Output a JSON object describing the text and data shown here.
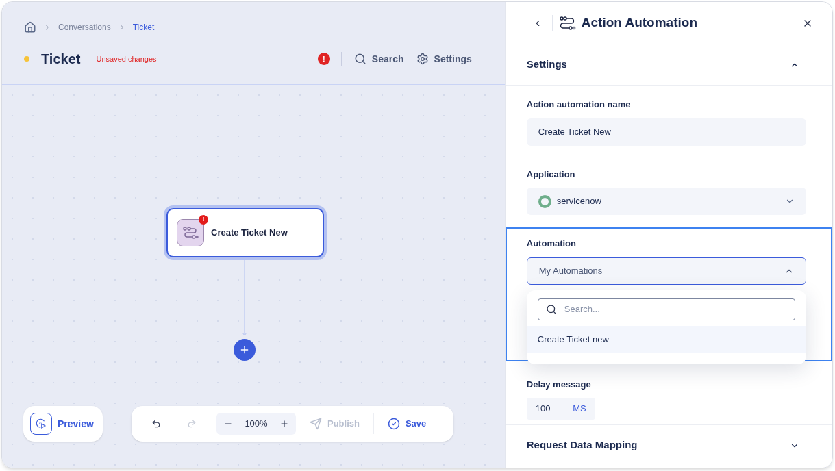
{
  "breadcrumb": [
    {
      "label": "Conversations",
      "current": false
    },
    {
      "label": "Ticket",
      "current": true
    }
  ],
  "header": {
    "title": "Ticket",
    "unsaved": true,
    "status": "Unsaved changes",
    "error": true,
    "error_mark": "!",
    "actions": [
      {
        "kind": "search",
        "label": "Search"
      },
      {
        "kind": "settings",
        "label": "Settings"
      }
    ]
  },
  "canvas": {
    "nodes": [
      {
        "label": "Create Ticket New",
        "selected": true,
        "error": true,
        "error_mark": "!"
      }
    ]
  },
  "toolbar": {
    "preview": "Preview",
    "undo": {
      "disabled": false
    },
    "redo": {
      "disabled": true
    },
    "zoom": "100%",
    "publish": {
      "label": "Publish",
      "disabled": true
    },
    "save": {
      "label": "Save",
      "disabled": false
    }
  },
  "panel": {
    "title": "Action Automation",
    "settings": {
      "title": "Settings",
      "expanded": true
    },
    "name_field": {
      "label": "Action automation name",
      "value": "Create Ticket New"
    },
    "application": {
      "label": "Application",
      "value": "servicenow"
    },
    "automation": {
      "label": "Automation",
      "value": "My Automations",
      "open": true,
      "search_placeholder": "Search...",
      "options": [
        {
          "label": "Create Ticket new",
          "selected": true
        }
      ]
    },
    "delay": {
      "label": "Delay message",
      "value": "100",
      "unit": "MS"
    },
    "mapping": {
      "title": "Request Data Mapping",
      "expanded": false
    }
  }
}
